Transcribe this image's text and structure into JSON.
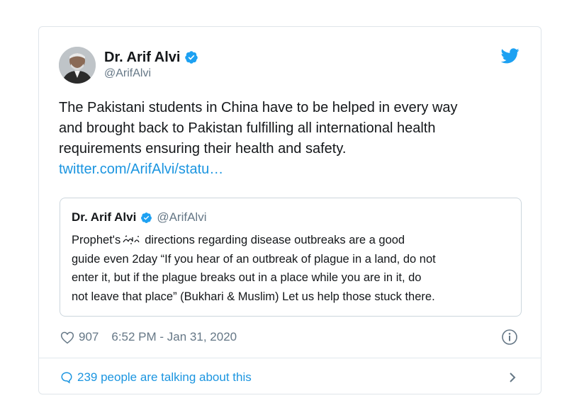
{
  "tweet": {
    "author_name": "Dr. Arif Alvi",
    "handle": "@ArifAlvi",
    "text_lines": [
      "The Pakistani students in China have to be helped in every way",
      "and brought back to Pakistan fulfilling all international health",
      "requirements ensuring their health  and safety."
    ],
    "link": "twitter.com/ArifAlvi/statu…",
    "likes": "907",
    "timestamp": "6:52 PM - Jan 31, 2020",
    "talking": "239 people are talking about this"
  },
  "quote": {
    "author_name": "Dr. Arif Alvi",
    "handle": "@ArifAlvi",
    "line1_before": "Prophet's",
    "line1_after": "directions regarding disease outbreaks are a good",
    "lines": [
      "guide even 2day “If you hear of an outbreak of plague in a land, do not",
      "enter it, but if the plague breaks out in a place while you are in it, do",
      "not leave that place” (Bukhari & Muslim) Let us help those stuck there."
    ]
  },
  "icons": {
    "verified": "verified-badge-icon",
    "bird": "twitter-bird-icon",
    "heart": "heart-icon",
    "info": "info-icon",
    "bubble": "speech-bubble-icon",
    "chevron": "chevron-right-icon"
  },
  "colors": {
    "accent": "#1b95e0",
    "text": "#14171a",
    "secondary": "#657786",
    "border": "#dfe5ea"
  }
}
